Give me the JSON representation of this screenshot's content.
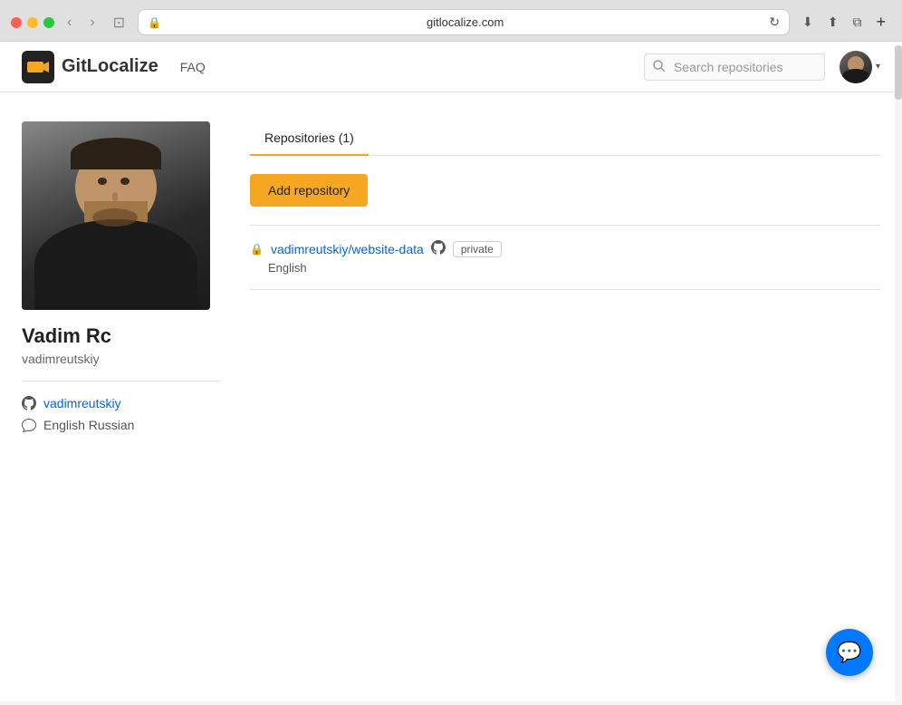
{
  "browser": {
    "url": "gitlocalize.com",
    "lock_icon": "🔒",
    "reload_icon": "↻",
    "back_icon": "‹",
    "forward_icon": "›",
    "sidebar_icon": "⊡",
    "download_icon": "⬇",
    "share_icon": "⬆",
    "tabs_icon": "⧉",
    "new_tab_icon": "+"
  },
  "navbar": {
    "brand_name": "GitLocalize",
    "faq_label": "FAQ",
    "search_placeholder": "Search repositories",
    "dropdown_arrow": "▾"
  },
  "sidebar": {
    "profile_name": "Vadim Rc",
    "profile_username": "vadimreutskiy",
    "github_link_text": "vadimreutskiy",
    "languages_text": "English Russian",
    "github_icon": "github",
    "chat_icon": "chat"
  },
  "main": {
    "tab_label": "Repositories (1)",
    "add_repo_label": "Add repository",
    "repos": [
      {
        "name": "vadimreutskiy/website-data",
        "badge": "private",
        "language": "English",
        "lock": "🔒",
        "gh_icon": "⚙"
      }
    ]
  },
  "floating_btn": {
    "icon": "💬"
  }
}
